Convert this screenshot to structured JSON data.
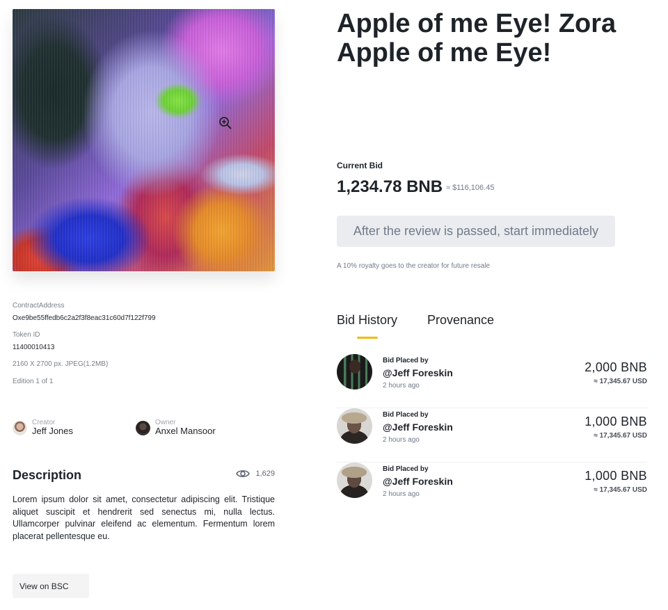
{
  "artwork": {
    "zoom_icon": "zoom-in-icon"
  },
  "meta": {
    "contract_label": "ContractAddress",
    "contract_value": "Oxe9be55ffedb6c2a2f3f8eac31c60d7f122f799",
    "token_label": "Token ID",
    "token_value": "11400010413",
    "dimensions": "2160 X 2700 px. JPEG(1.2MB)",
    "edition": "Edition 1 of 1"
  },
  "creator": {
    "role": "Creator",
    "name": "Jeff Jones"
  },
  "owner": {
    "role": "Owner",
    "name": "Anxel Mansoor"
  },
  "description": {
    "title": "Description",
    "views": "1,629",
    "body": "Lorem ipsum dolor sit amet, consectetur adipiscing elit. Tristique aliquet suscipit et hendrerit sed senectus mi, nulla lectus. Ullamcorper pulvinar eleifend ac elementum. Fermentum lorem placerat pellentesque eu."
  },
  "view_bsc_label": "View on BSC",
  "title": "Apple of me Eye! Zora Apple of me Eye!",
  "current_bid": {
    "label": "Current Bid",
    "amount": "1,234.78 BNB",
    "usd": "≈ $116,106.45"
  },
  "review_button_label": "After the review is passed, start immediately",
  "royalty_note": "A 10% royalty goes to the creator for future resale",
  "tabs": [
    {
      "label": "Bid History",
      "active": true
    },
    {
      "label": "Provenance",
      "active": false
    }
  ],
  "bids": [
    {
      "placed_by": "Bid Placed by",
      "bidder": "@Jeff Foreskin",
      "time": "2 hours ago",
      "amount": "2,000 BNB",
      "usd": "≈ 17,345.67 USD"
    },
    {
      "placed_by": "Bid Placed by",
      "bidder": "@Jeff Foreskin",
      "time": "2 hours ago",
      "amount": "1,000 BNB",
      "usd": "≈ 17,345.67 USD"
    },
    {
      "placed_by": "Bid Placed by",
      "bidder": "@Jeff Foreskin",
      "time": "2 hours ago",
      "amount": "1,000 BNB",
      "usd": "≈ 17,345.67 USD"
    }
  ],
  "colors": {
    "accent": "#f0b90b",
    "text": "#1e2329",
    "muted": "#707a8a",
    "button_bg": "#eaecef"
  }
}
